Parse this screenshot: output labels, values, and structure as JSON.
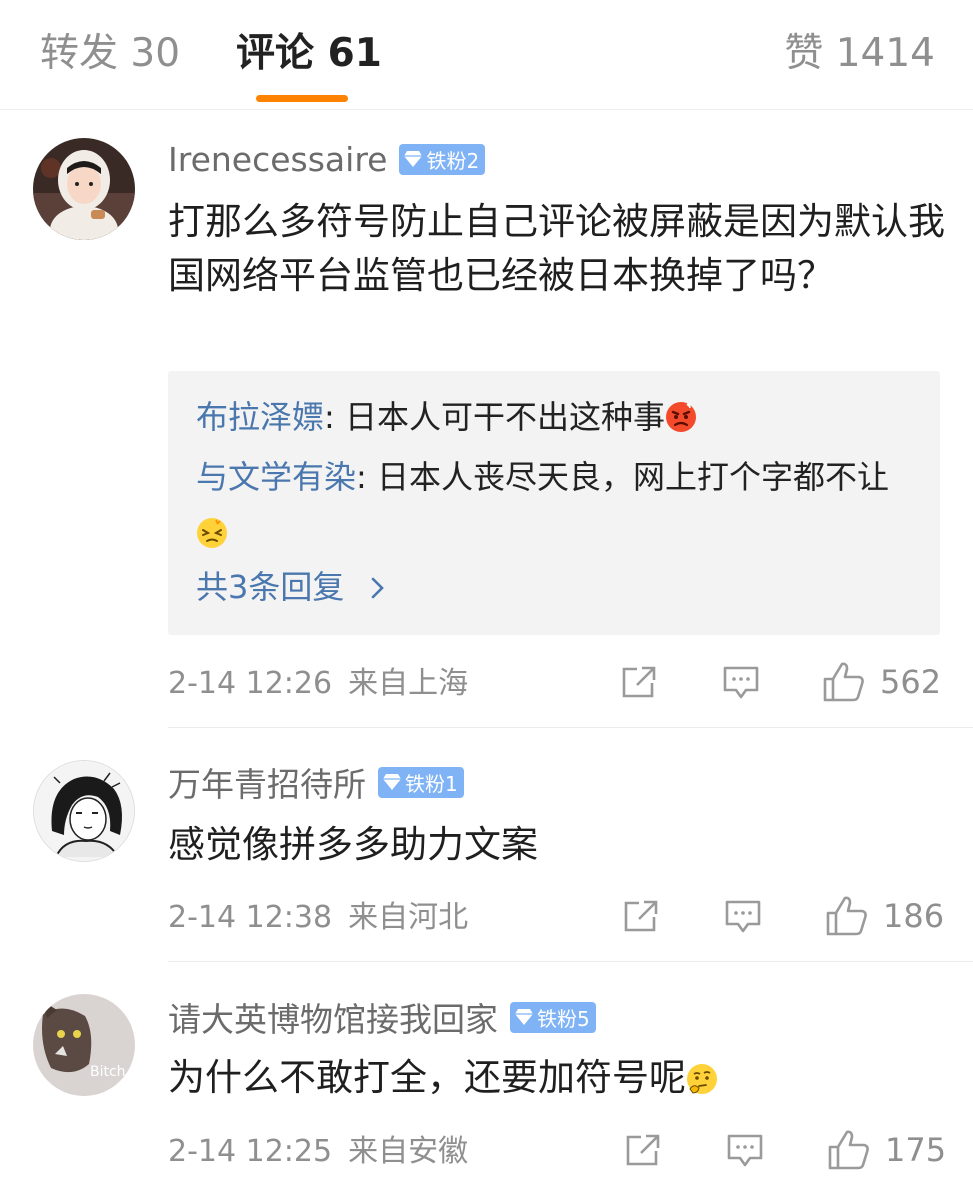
{
  "tabs": {
    "repost": "转发 30",
    "comments": "评论 61",
    "likes": "赞 1414"
  },
  "colors": {
    "accent": "#ff8200",
    "link": "#4a77ad",
    "badge": "#7fb3f5"
  },
  "comments": [
    {
      "username": "Irenecessaire",
      "badge": "铁粉2",
      "text": "打那么多符号防止自己评论被屏蔽是因为默认我国网络平台监管也已经被日本换掉了吗？",
      "replies": [
        {
          "author": "布拉泽嫖",
          "text": ": 日本人可干不出这种事",
          "emoji": "angry-emoji"
        },
        {
          "author": "与文学有染",
          "text": ": 日本人丧尽天良，网上打个字都不让",
          "emoji": "dizzy-emoji"
        }
      ],
      "more_replies": "共3条回复",
      "time": "2-14 12:26",
      "location": "来自上海",
      "likes": "562"
    },
    {
      "username": "万年青招待所",
      "badge": "铁粉1",
      "text": "感觉像拼多多助力文案",
      "time": "2-14 12:38",
      "location": "来自河北",
      "likes": "186"
    },
    {
      "username": "请大英博物馆接我回家",
      "badge": "铁粉5",
      "text": "为什么不敢打全，还要加符号呢",
      "emoji": "thinking-emoji",
      "avatar_text": "Bitch",
      "time": "2-14 12:25",
      "location": "来自安徽",
      "likes": "175"
    }
  ]
}
